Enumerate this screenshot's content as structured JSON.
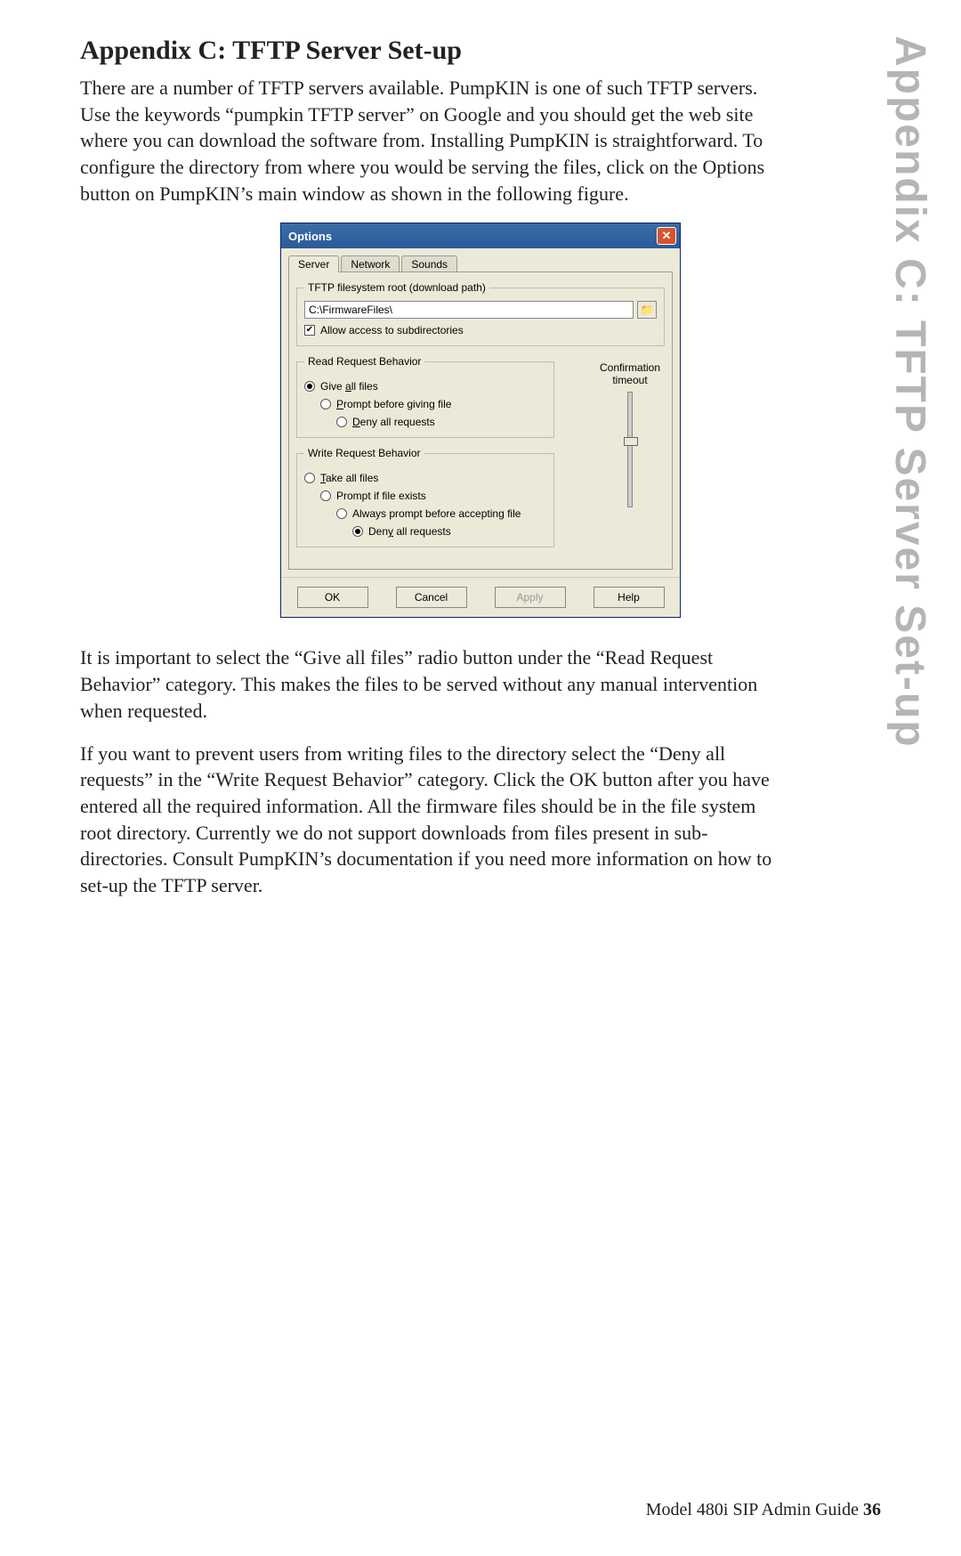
{
  "heading": "Appendix C: TFTP Server Set-up",
  "side_tab": "Appendix C: TFTP Server Set-up",
  "para1": "There are a number of TFTP servers available. PumpKIN is one of such TFTP servers. Use the keywords “pumpkin TFTP server” on Google and you should get the web site where you can download the software from. Installing PumpKIN is straightforward. To configure the directory from where you would be serving the files, click on the Options button on PumpKIN’s main window as shown in the following figure.",
  "para2": "It is important to select the “Give all files” radio button under the “Read Request Behavior” category. This makes the files to be served without any manual intervention when requested.",
  "para3": "If you want to prevent users from writing files to the directory select the “Deny all requests” in the “Write Request Behavior” category. Click the OK button after you have entered all the required information. All the firmware files should be in the file system root directory. Currently we do not support downloads from files present in sub-directories. Consult PumpKIN’s documentation if you need more information on how to set-up the TFTP server.",
  "dialog": {
    "title": "Options",
    "tabs": {
      "server": "Server",
      "network": "Network",
      "sounds": "Sounds"
    },
    "fsroot_group": "TFTP filesystem root (download path)",
    "fsroot_value": "C:\\FirmwareFiles\\",
    "allow_sub": "Allow access to subdirectories",
    "read_group": "Read Request Behavior",
    "read_give_pre": "Give ",
    "read_give_mid": "a",
    "read_give_post": "ll files",
    "read_prompt_pre": "P",
    "read_prompt_post": "rompt before giving file",
    "read_deny_pre": "D",
    "read_deny_post": "eny all requests",
    "write_group": "Write Request Behavior",
    "write_take_pre": "T",
    "write_take_post": "ake all files",
    "write_prompt": "Prompt if file exists",
    "write_always": "Always prompt before accepting file",
    "write_deny_pre": "Den",
    "write_deny_mid": "y",
    "write_deny_post": " all requests",
    "confirm_label1": "Confirmation",
    "confirm_label2": "timeout",
    "buttons": {
      "ok": "OK",
      "cancel": "Cancel",
      "apply": "Apply",
      "help": "Help"
    }
  },
  "footer": {
    "text": "Model 480i SIP Admin Guide",
    "page": "36"
  }
}
